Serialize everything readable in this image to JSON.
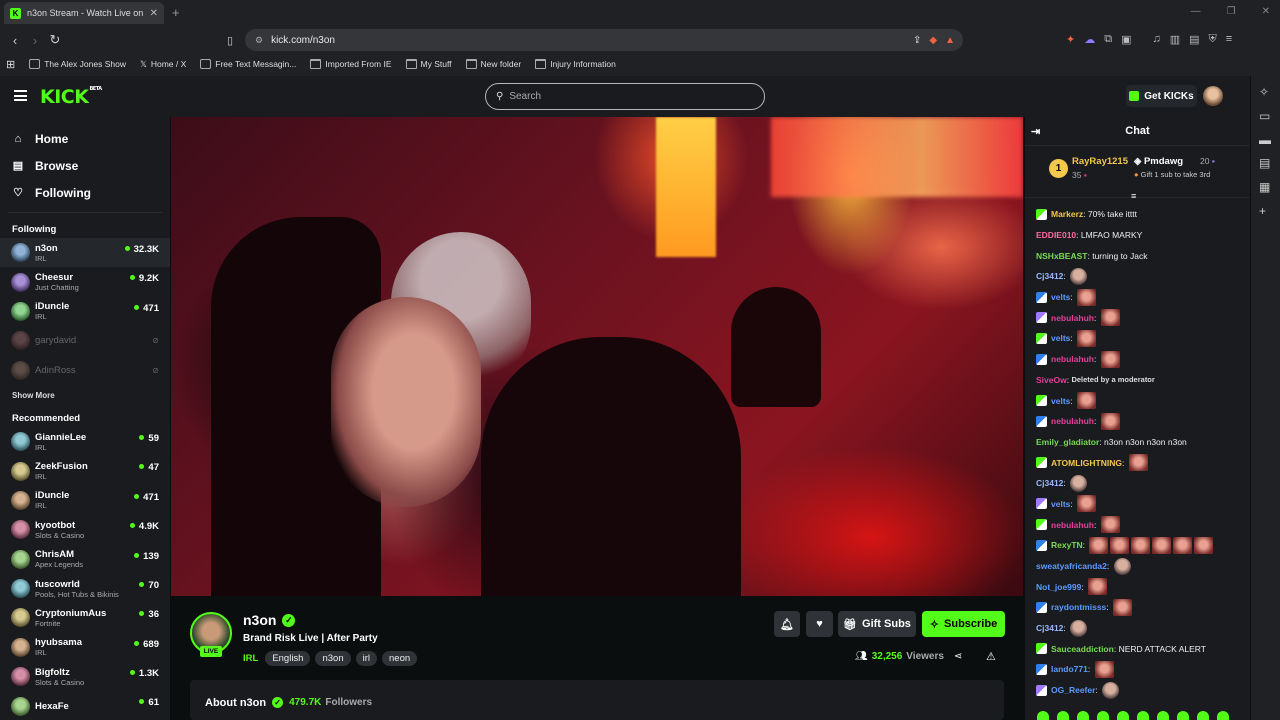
{
  "browser": {
    "tab_title": "n3on Stream - Watch Live on",
    "url": "kick.com/n3on",
    "bookmarks": [
      "The Alex Jones Show",
      "Home / X",
      "Free Text Messagin...",
      "Imported From IE",
      "My Stuff",
      "New folder",
      "Injury Information"
    ]
  },
  "header": {
    "logo": "KICK",
    "logo_beta": "BETA",
    "search_placeholder": "Search",
    "get_kicks": "Get KICKs"
  },
  "sidebar": {
    "nav": [
      {
        "label": "Home",
        "icon": "home-icon"
      },
      {
        "label": "Browse",
        "icon": "browse-icon"
      },
      {
        "label": "Following",
        "icon": "heart-icon"
      }
    ],
    "following_title": "Following",
    "following": [
      {
        "name": "n3on",
        "category": "IRL",
        "viewers": "32.3K"
      },
      {
        "name": "Cheesur",
        "category": "Just Chatting",
        "viewers": "9.2K"
      },
      {
        "name": "iDuncle",
        "category": "IRL",
        "viewers": "471"
      },
      {
        "name": "garydavid",
        "category": "",
        "viewers": ""
      },
      {
        "name": "AdinRoss",
        "category": "",
        "viewers": ""
      }
    ],
    "show_more": "Show More",
    "recommended_title": "Recommended",
    "recommended": [
      {
        "name": "GiannieLee",
        "category": "IRL",
        "viewers": "59"
      },
      {
        "name": "ZeekFusion",
        "category": "IRL",
        "viewers": "47"
      },
      {
        "name": "iDuncle",
        "category": "IRL",
        "viewers": "471"
      },
      {
        "name": "kyootbot",
        "category": "Slots & Casino",
        "viewers": "4.9K"
      },
      {
        "name": "ChrisAM",
        "category": "Apex Legends",
        "viewers": "139"
      },
      {
        "name": "fuscowrld",
        "category": "Pools, Hot Tubs & Bikinis",
        "viewers": "70"
      },
      {
        "name": "CryptoniumAus",
        "category": "Fortnite",
        "viewers": "36"
      },
      {
        "name": "hyubsama",
        "category": "IRL",
        "viewers": "689"
      },
      {
        "name": "Bigfoltz",
        "category": "Slots & Casino",
        "viewers": "1.3K"
      },
      {
        "name": "HexaFe",
        "category": "",
        "viewers": "61"
      }
    ]
  },
  "stream": {
    "streamer": "n3on",
    "live_badge": "LIVE",
    "title": "Brand Risk Live | After Party",
    "category": "IRL",
    "tags": [
      "English",
      "n3on",
      "irl",
      "neon"
    ],
    "gift_subs": "Gift Subs",
    "subscribe": "Subscribe",
    "viewer_count": "32,256",
    "viewers_label": "Viewers",
    "about_label": "About n3on",
    "followers_count": "479.7K",
    "followers_label": "Followers"
  },
  "chat": {
    "title": "Chat",
    "leaderboard": {
      "first_name": "RayRay1215",
      "first_count": "35",
      "second_name": "Pmdawg",
      "second_count": "20",
      "second_hint": "Gift 1 sub to take 3rd"
    },
    "messages": [
      {
        "user": "Markerz",
        "text": "70% take itttt",
        "color": "#f2c94c",
        "badge": true,
        "emotes": 0
      },
      {
        "user": "EDDIE010",
        "text": "LMFAO MARKY",
        "color": "#ff6b9d",
        "badge": false,
        "emotes": 0
      },
      {
        "user": "NSHxBEAST",
        "text": "turning to Jack",
        "color": "#7bd957",
        "badge": false,
        "emotes": 0
      },
      {
        "user": "Cj3412",
        "text": "",
        "color": "#9ab8ff",
        "badge": false,
        "emotes": 1,
        "face": true
      },
      {
        "user": "velts",
        "text": "",
        "color": "#5b9bff",
        "badge": true,
        "emotes": 1
      },
      {
        "user": "nebulahuh",
        "text": "",
        "color": "#e0409a",
        "badge": true,
        "emotes": 1
      },
      {
        "user": "velts",
        "text": "",
        "color": "#5b9bff",
        "badge": true,
        "emotes": 1
      },
      {
        "user": "nebulahuh",
        "text": "",
        "color": "#e0409a",
        "badge": true,
        "emotes": 1
      },
      {
        "user": "SiveOw",
        "text": "Deleted by a moderator",
        "color": "#e0409a",
        "badge": false,
        "emotes": 0,
        "mod": true
      },
      {
        "user": "velts",
        "text": "",
        "color": "#5b9bff",
        "badge": true,
        "emotes": 1
      },
      {
        "user": "nebulahuh",
        "text": "",
        "color": "#e0409a",
        "badge": true,
        "emotes": 1
      },
      {
        "user": "Emily_gladiator",
        "text": "n3on n3on n3on n3on",
        "color": "#7bd957",
        "badge": false,
        "emotes": 0
      },
      {
        "user": "ATOMLIGHTNING",
        "text": "",
        "color": "#f2c94c",
        "badge": true,
        "emotes": 1
      },
      {
        "user": "Cj3412",
        "text": "",
        "color": "#9ab8ff",
        "badge": false,
        "emotes": 1,
        "face": true
      },
      {
        "user": "velts",
        "text": "",
        "color": "#5b9bff",
        "badge": true,
        "emotes": 1
      },
      {
        "user": "nebulahuh",
        "text": "",
        "color": "#e0409a",
        "badge": true,
        "emotes": 1
      },
      {
        "user": "RexyTN",
        "text": "",
        "color": "#7bd957",
        "badge": true,
        "emotes": 6
      },
      {
        "user": "sweatyafricanda2",
        "text": "",
        "color": "#5b9bff",
        "badge": false,
        "emotes": 1,
        "face": true
      },
      {
        "user": "Not_joe999",
        "text": "",
        "color": "#5b9bff",
        "badge": false,
        "emotes": 1
      },
      {
        "user": "raydontmisss",
        "text": "",
        "color": "#5b9bff",
        "badge": true,
        "emotes": 1
      },
      {
        "user": "Cj3412",
        "text": "",
        "color": "#9ab8ff",
        "badge": false,
        "emotes": 1,
        "face": true
      },
      {
        "user": "Sauceaddiction",
        "text": "NERD ATTACK ALERT",
        "color": "#7bd957",
        "badge": true,
        "emotes": 0
      },
      {
        "user": "lando771",
        "text": "",
        "color": "#5b9bff",
        "badge": true,
        "emotes": 1
      },
      {
        "user": "OG_Reefer",
        "text": "",
        "color": "#5b9bff",
        "badge": true,
        "emotes": 1,
        "face": true
      }
    ]
  },
  "colors": {
    "accent": "#53fc18",
    "bg": "#0b0e0f",
    "panel": "#191b1f"
  }
}
